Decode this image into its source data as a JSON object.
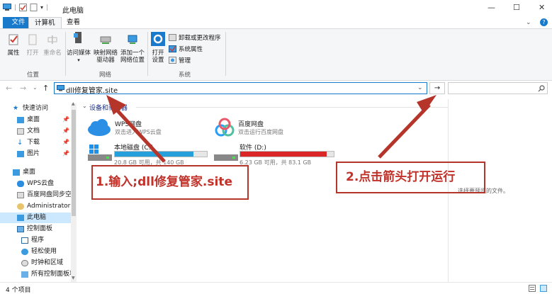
{
  "window": {
    "title": "此电脑",
    "min": "—",
    "max": "☐",
    "close": "✕"
  },
  "tabs": {
    "file": "文件",
    "computer": "计算机",
    "view": "查看"
  },
  "ribbon": {
    "properties": "属性",
    "open": "打开",
    "rename": "重命名",
    "access_media_1": "访问媒体",
    "map_drive_1": "映射网络",
    "map_drive_2": "驱动器",
    "add_location_1": "添加一个",
    "add_location_2": "网络位置",
    "open_settings_1": "打开",
    "open_settings_2": "设置",
    "uninstall": "卸载或更改程序",
    "system_props": "系统属性",
    "manage": "管理",
    "group_location": "位置",
    "group_network": "网络",
    "group_system": "系统"
  },
  "address": {
    "value": "dll修复管家.site",
    "go": "→"
  },
  "nav": {
    "quick_access": "快速访问",
    "desktop1": "桌面",
    "documents": "文档",
    "downloads": "下载",
    "pictures": "图片",
    "desktop2": "桌面",
    "wps": "WPS云盘",
    "baidu_sync": "百度网盘同步空间",
    "admin": "Administrator",
    "this_pc": "此电脑",
    "control_panel": "控制面板",
    "programs": "程序",
    "ease": "轻松使用",
    "clock": "时钟和区域",
    "all_cp": "所有控制面板项"
  },
  "content": {
    "section_header": "设备和驱动器",
    "wps_name": "WPS网盘",
    "wps_desc": "双击进入WPS云盘",
    "baidu_name": "百度网盘",
    "baidu_desc": "双击运行百度网盘",
    "c_name": "本地磁盘 (C:)",
    "c_space": "20.8 GB 可用，共 140 GB",
    "c_used_fraction": 0.85,
    "d_name": "软件 (D:)",
    "d_space": "6.23 GB 可用，共 83.1 GB",
    "d_used_fraction": 0.925,
    "preview_hint": "选择要预览的文件。"
  },
  "status": {
    "count": "4 个项目"
  },
  "annotations": {
    "step1": "1.输入;dll修复管家.site",
    "step2": "2.点击箭头打开运行"
  },
  "colors": {
    "accent": "#1979ca",
    "drive_c": "#26a0da",
    "drive_d": "#da2626",
    "annotation": "#b5352a"
  }
}
